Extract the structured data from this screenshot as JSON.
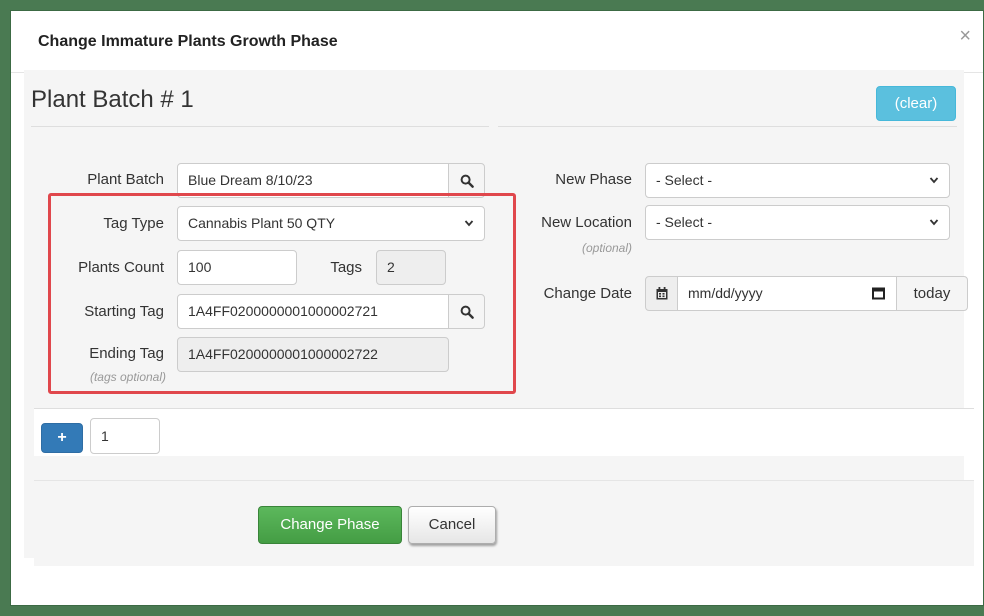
{
  "modal": {
    "title": "Change Immature Plants Growth Phase",
    "close_glyph": "×"
  },
  "batch": {
    "heading": "Plant Batch # 1",
    "clear_label": "(clear)"
  },
  "left": {
    "plant_batch_label": "Plant Batch",
    "plant_batch_value": "Blue Dream 8/10/23",
    "tag_type_label": "Tag Type",
    "tag_type_value": "Cannabis Plant 50 QTY",
    "plants_count_label": "Plants Count",
    "plants_count_value": "100",
    "tags_label": "Tags",
    "tags_value": "2",
    "starting_tag_label": "Starting Tag",
    "starting_tag_value": "1A4FF0200000001000002721",
    "ending_tag_label": "Ending Tag",
    "ending_tag_sublabel": "(tags optional)",
    "ending_tag_value": "1A4FF0200000001000002722"
  },
  "right": {
    "new_phase_label": "New Phase",
    "new_phase_value": "- Select -",
    "new_location_label": "New Location",
    "new_location_sublabel": "(optional)",
    "new_location_value": "- Select -",
    "change_date_label": "Change Date",
    "change_date_placeholder": "mm/dd/yyyy",
    "today_label": "today"
  },
  "strip": {
    "plus_glyph": "+",
    "count_value": "1"
  },
  "footer": {
    "submit_label": "Change Phase",
    "cancel_label": "Cancel"
  },
  "icons": {
    "search": "search-icon",
    "calendar": "calendar-icon",
    "caret": "chevron-down-icon"
  },
  "colors": {
    "frame": "#4a7a52",
    "info": "#5bc0de",
    "primary": "#337ab7",
    "success": "#5cb85c",
    "highlight": "#e0474c"
  }
}
